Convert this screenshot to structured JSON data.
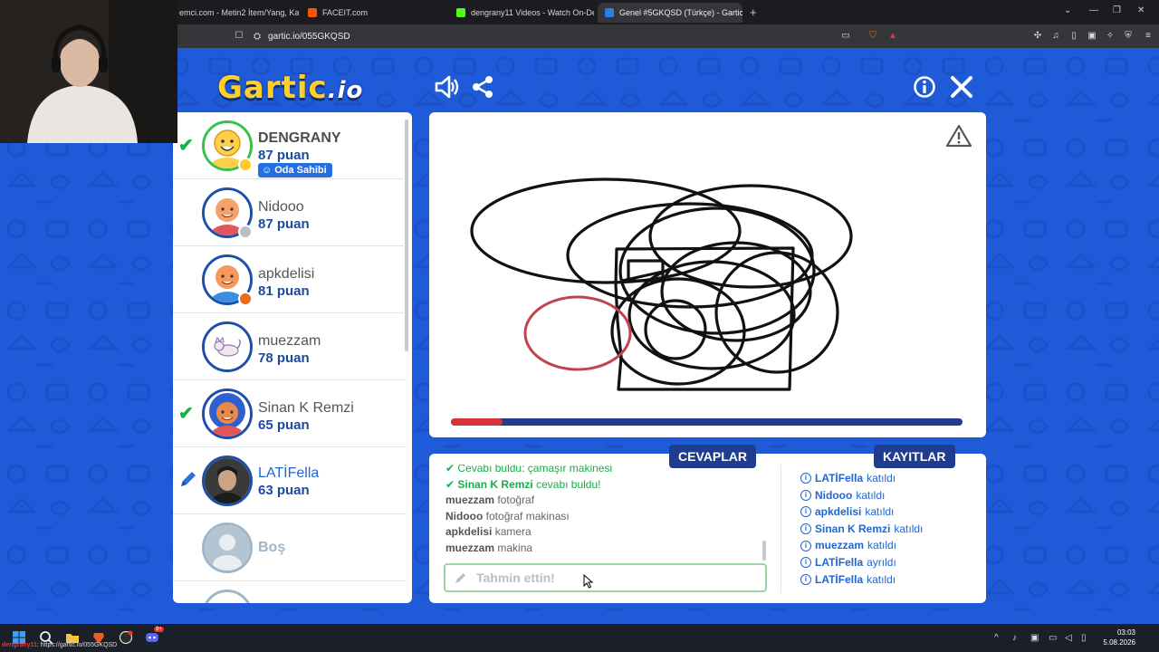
{
  "browser": {
    "tabs": [
      {
        "title": "emci.com - Metin2 İtem/Yang, Karak",
        "favicon_color": "#e24b2b"
      },
      {
        "title": "FACEIT.com",
        "favicon_color": "#ff5500"
      },
      {
        "title": "dengrany11 Videos - Watch On-Dem",
        "favicon_color": "#53fc18"
      },
      {
        "title": "Genel #5GKQSD (Türkçe) - Gartic",
        "favicon_color": "#2e7de0",
        "active": true
      }
    ],
    "new_tab": "+",
    "url": "gartic.io/055GKQSD"
  },
  "game": {
    "logo_main": "Gartic",
    "logo_suffix": ".io",
    "players": [
      {
        "name": "DENGRANY",
        "score": "87 puan",
        "guessed": true,
        "owner": true,
        "badge": "Oda Sahibi",
        "status_color": "#ffc928",
        "skin": "#ffcf4a",
        "shirt": "#ffcf4a"
      },
      {
        "name": "Nidooo",
        "score": "87 puan",
        "guessed": false,
        "status_color": "#b9bec6",
        "skin": "#f5a26c",
        "shirt": "#e0565b"
      },
      {
        "name": "apkdelisi",
        "score": "81 puan",
        "guessed": false,
        "status_color": "#e86a1a",
        "skin": "#f59a5c",
        "shirt": "#3a8fe0"
      },
      {
        "name": "muezzam",
        "score": "78 puan",
        "guessed": false,
        "status_color": "",
        "skin": "",
        "shirt": ""
      },
      {
        "name": "Sinan K Remzi",
        "score": "65 puan",
        "guessed": true,
        "status_color": "",
        "skin": "#e88a4c",
        "shirt": "#e0565b"
      },
      {
        "name": "LATİFella",
        "score": "63 puan",
        "drawing": true,
        "status_color": "",
        "skin": "",
        "shirt": ""
      },
      {
        "name": "Boş",
        "score": "",
        "empty": true,
        "status_color": "",
        "skin": "",
        "shirt": ""
      }
    ],
    "timer_progress": 0.1,
    "answers_tab": "CEVAPLAR",
    "logs_tab": "KAYITLAR",
    "answers": [
      {
        "user": "",
        "text": "Cevabı buldu: çamaşır makinesi",
        "correct": true
      },
      {
        "user": "Sinan K Remzi",
        "text": "cevabı buldu!",
        "correct": true
      },
      {
        "user": "muezzam",
        "text": "fotoğraf",
        "correct": false
      },
      {
        "user": "Nidooo",
        "text": "fotoğraf makinası",
        "correct": false
      },
      {
        "user": "apkdelisi",
        "text": "kamera",
        "correct": false
      },
      {
        "user": "muezzam",
        "text": "makina",
        "correct": false
      }
    ],
    "guess_placeholder": "Tahmin ettin!",
    "logs": [
      {
        "user": "LATİFella",
        "text": "katıldı"
      },
      {
        "user": "Nidooo",
        "text": "katıldı"
      },
      {
        "user": "apkdelisi",
        "text": "katıldı"
      },
      {
        "user": "Sinan K Remzi",
        "text": "katıldı"
      },
      {
        "user": "muezzam",
        "text": "katıldı"
      },
      {
        "user": "LATİFella",
        "text": "ayrıldı"
      },
      {
        "user": "LATİFella",
        "text": "katıldı"
      }
    ]
  },
  "taskbar": {
    "stream_user": "dengrany11",
    "stream_url": ": https://gartic.io/055GKQSD",
    "time": "03:03",
    "date": "5.08.2026",
    "notification_count": "9+"
  },
  "colors": {
    "page_bg": "#1f5bd8",
    "accent_dark": "#1f3d8e",
    "correct": "#1aae48",
    "link_blue": "#2166d6",
    "timer_red": "#d8323a"
  }
}
